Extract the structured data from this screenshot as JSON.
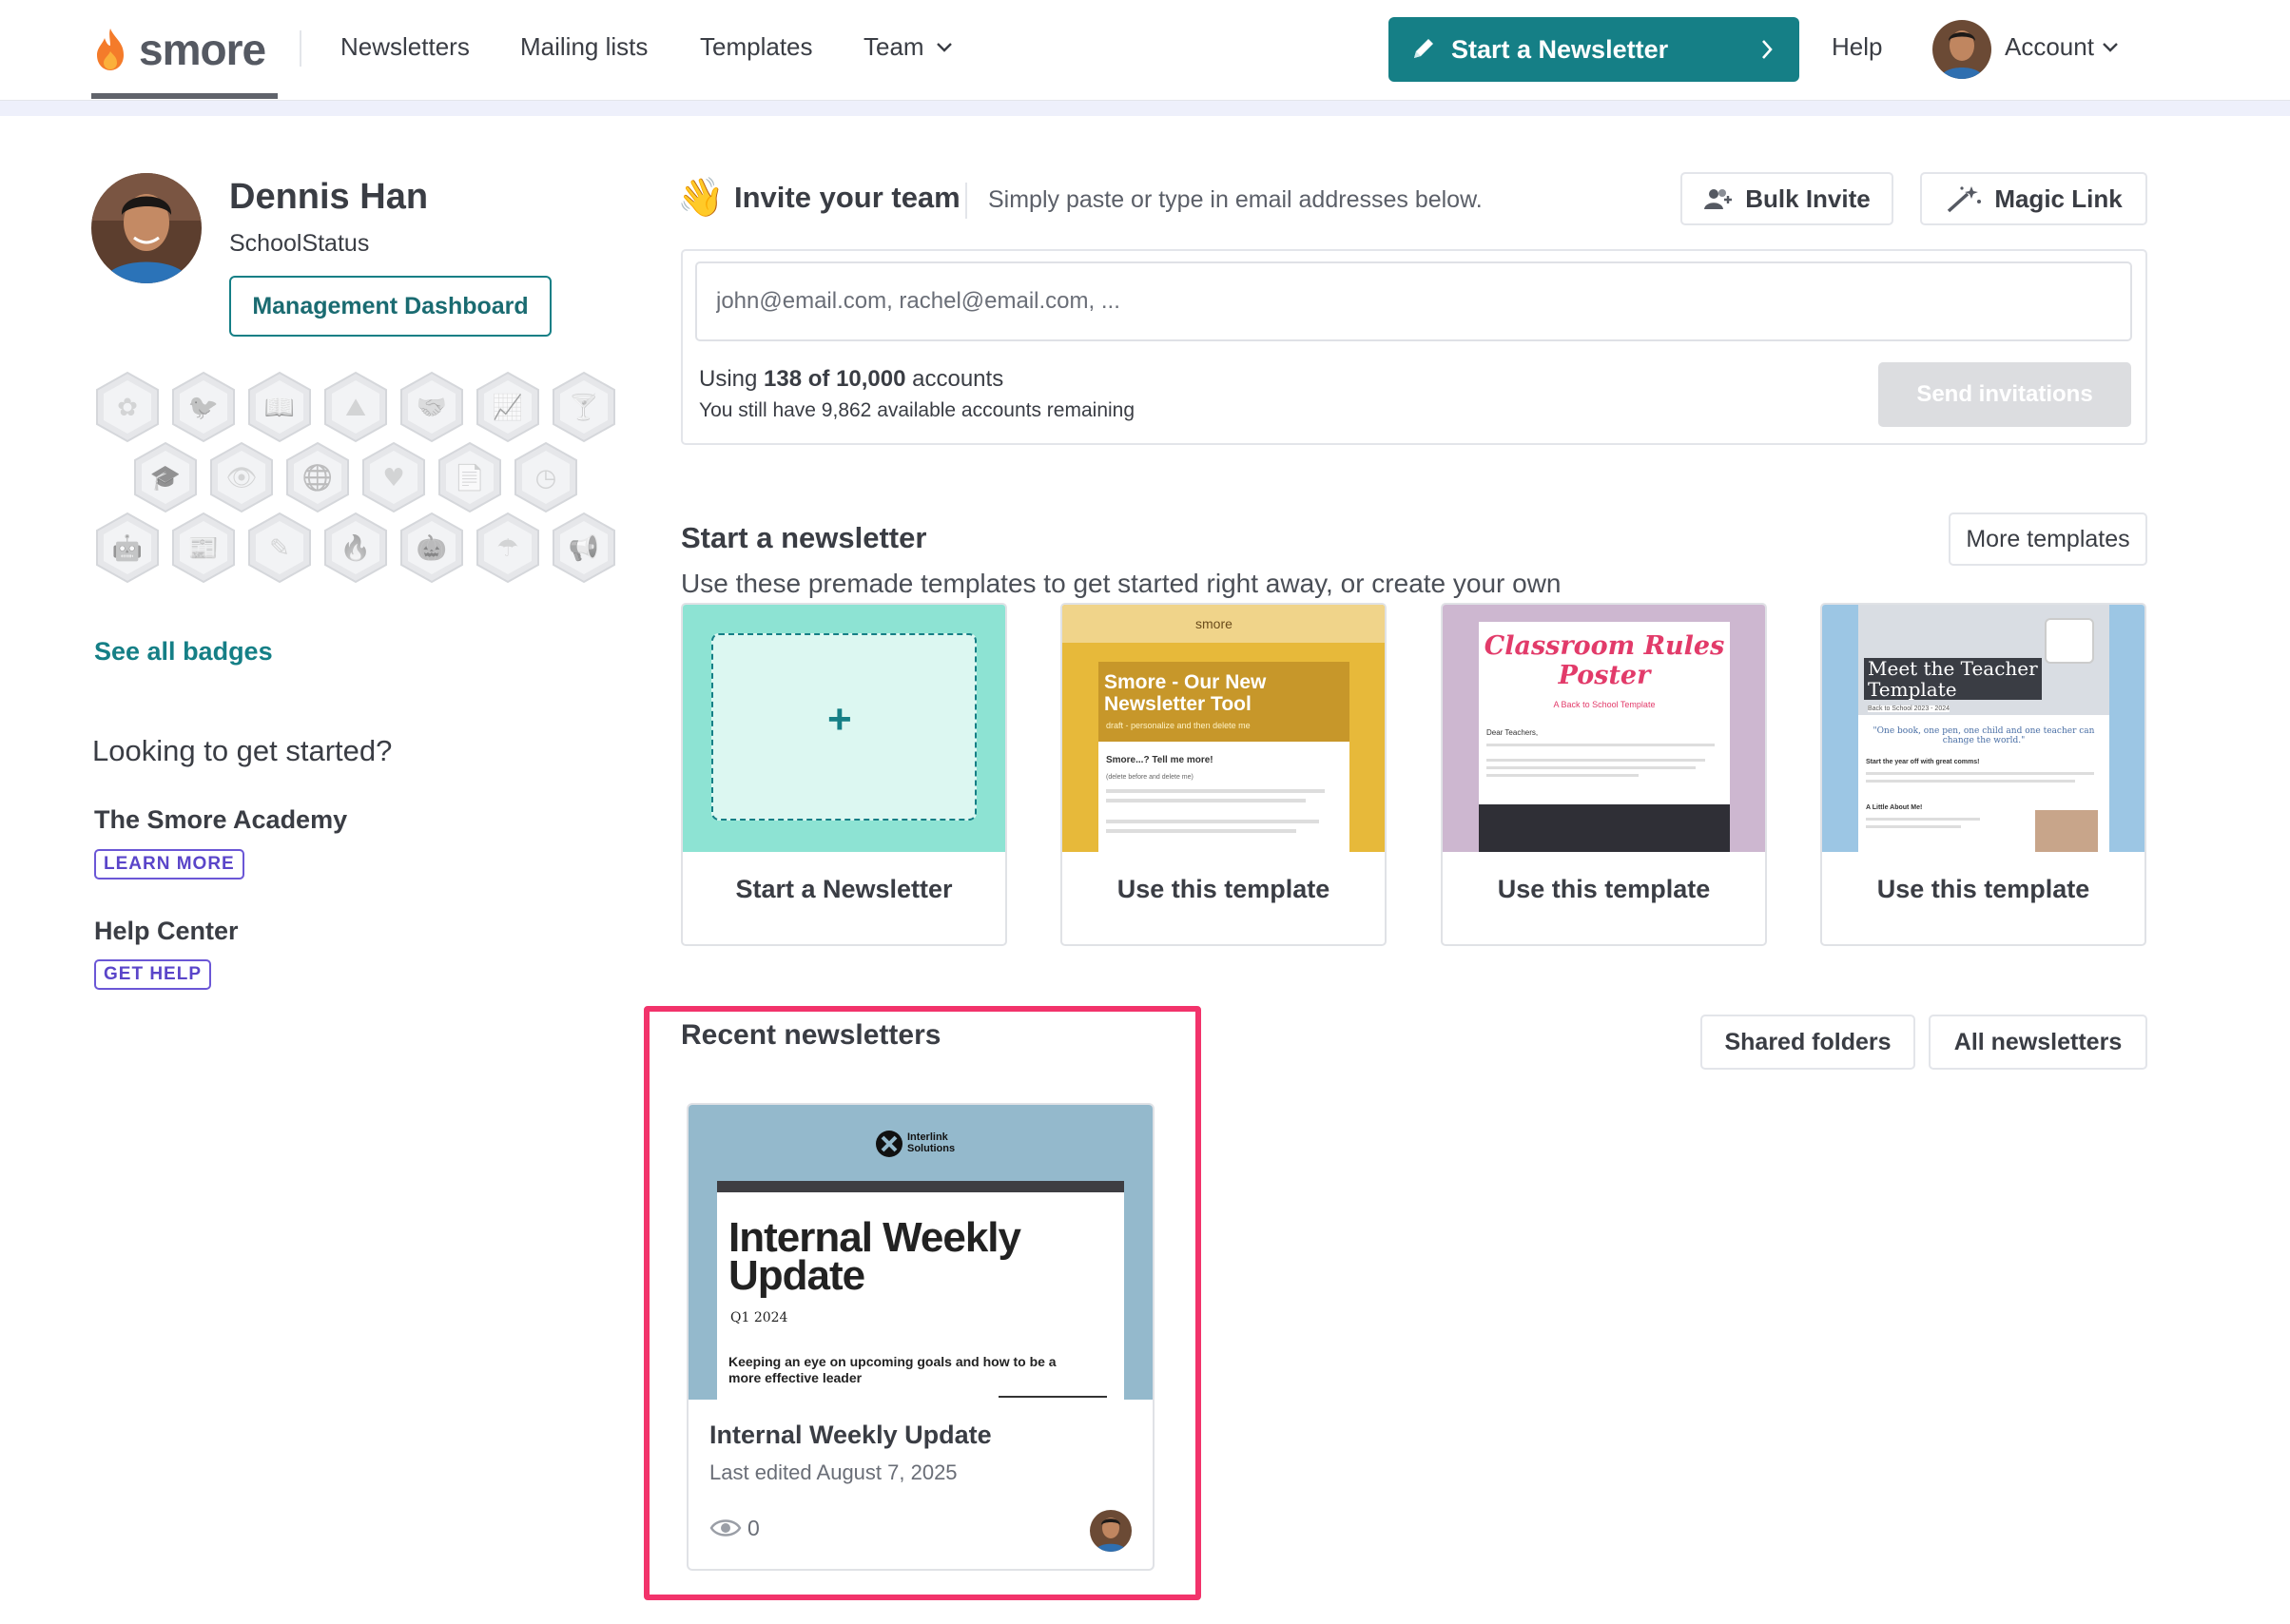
{
  "header": {
    "logo_text": "smore",
    "nav": [
      "Newsletters",
      "Mailing lists",
      "Templates",
      "Team"
    ],
    "start_button": "Start a Newsletter",
    "help": "Help",
    "account": "Account"
  },
  "profile": {
    "name": "Dennis Han",
    "org": "SchoolStatus",
    "dashboard_button": "Management Dashboard"
  },
  "badges": {
    "icons": [
      "flower-badge-icon",
      "twitter-badge-icon",
      "book-badge-icon",
      "mountain-badge-icon",
      "handshake-badge-icon",
      "chart-badge-icon",
      "cocktail-badge-icon",
      "graduation-cap-badge-icon",
      "eye-badge-icon",
      "globe-badge-icon",
      "heart-badge-icon",
      "document-badge-icon",
      "clock-badge-icon",
      "android-badge-icon",
      "newspaper-badge-icon",
      "edit-badge-icon",
      "flame-badge-icon",
      "pumpkin-badge-icon",
      "umbrella-badge-icon",
      "megaphone-badge-icon"
    ],
    "see_all": "See all badges"
  },
  "sidebar": {
    "looking": "Looking to get started?",
    "academy_title": "The Smore Academy",
    "academy_pill": "LEARN MORE",
    "help_title": "Help Center",
    "help_pill": "GET HELP"
  },
  "invite": {
    "emoji": "👋",
    "title": "Invite your team",
    "subtitle": "Simply paste or type in email addresses below.",
    "bulk_invite": "Bulk Invite",
    "magic_link": "Magic Link",
    "placeholder": "john@email.com, rachel@email.com, ...",
    "usage_prefix": "Using ",
    "usage_bold": "138 of 10,000",
    "usage_suffix": " accounts",
    "remaining": "You still have 9,862 available accounts remaining",
    "send_button": "Send invitations"
  },
  "start_section": {
    "title": "Start a newsletter",
    "subtitle": "Use these premade templates to get started right away, or create your own",
    "more_templates": "More templates",
    "cards": [
      {
        "label": "Start a Newsletter",
        "plus": "+"
      },
      {
        "label": "Use this template",
        "thumb_brand": "smore",
        "thumb_title_1": "Smore - Our New",
        "thumb_title_2": "Newsletter Tool",
        "thumb_caption": "draft - personalize and then delete me",
        "thumb_body_1": "Smore...? Tell me more!",
        "thumb_body_2": "(delete before and delete me)"
      },
      {
        "label": "Use this template",
        "thumb_title_1": "Classroom Rules",
        "thumb_title_2": "Poster",
        "thumb_caption": "A Back to School Template",
        "thumb_body_1": "Dear Teachers,"
      },
      {
        "label": "Use this template",
        "thumb_title_1": "Meet the Teacher",
        "thumb_title_2": "Template",
        "thumb_caption": "Back to School 2023 - 2024",
        "thumb_quote": "\"One book, one pen, one child and one teacher can change the world.\"",
        "thumb_body_1": "Start the year off with great comms!",
        "thumb_body_2": "A Little About Me!"
      }
    ]
  },
  "recent": {
    "title": "Recent newsletters",
    "shared_folders": "Shared folders",
    "all_newsletters": "All newsletters",
    "newsletter": {
      "brand_1": "Interlink",
      "brand_2": "Solutions",
      "thumb_title_1": "Internal Weekly",
      "thumb_title_2": "Update",
      "thumb_quarter": "Q1 2024",
      "thumb_tagline_1": "Keeping an eye on upcoming goals and how to be a",
      "thumb_tagline_2": "more effective leader",
      "title": "Internal Weekly Update",
      "edited": "Last edited August 7, 2025",
      "views": "0"
    }
  },
  "colors": {
    "teal": "#157f86",
    "purple": "#5a45c9",
    "highlight": "#f2336b"
  }
}
